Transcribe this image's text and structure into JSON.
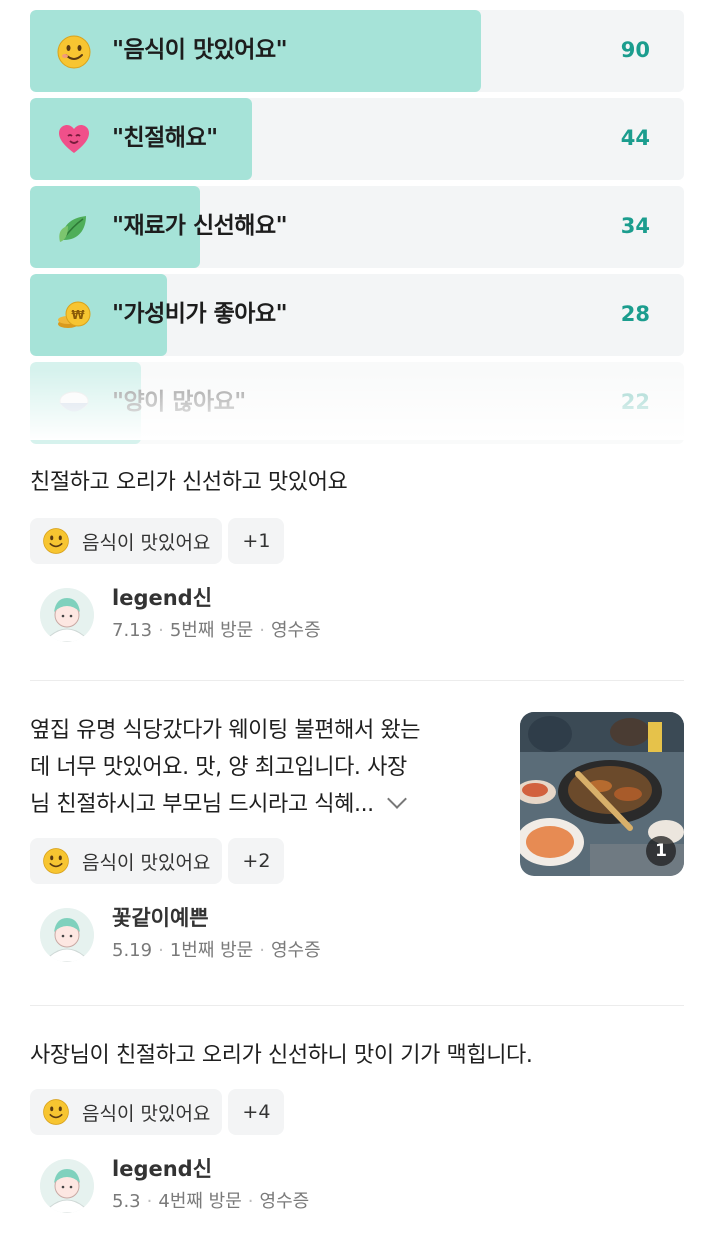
{
  "keywords": [
    {
      "label": "\"음식이 맛있어요\"",
      "count": "90",
      "fill": 0.69,
      "icon": "smile-icon"
    },
    {
      "label": "\"친절해요\"",
      "count": "44",
      "fill": 0.34,
      "icon": "heart-icon"
    },
    {
      "label": "\"재료가 신선해요\"",
      "count": "34",
      "fill": 0.26,
      "icon": "leaf-icon"
    },
    {
      "label": "\"가성비가 좋아요\"",
      "count": "28",
      "fill": 0.21,
      "icon": "coin-icon"
    },
    {
      "label": "\"양이 많아요\"",
      "count": "22",
      "fill": 0.17,
      "icon": "rice-bowl-icon"
    }
  ],
  "reviews": [
    {
      "text": "친절하고 오리가 신선하고 맛있어요",
      "tag": "음식이 맛있어요",
      "more": "+1",
      "author": "legend신",
      "date": "7.13",
      "visit": "5번째 방문",
      "proof": "영수증"
    },
    {
      "text_lines": [
        "옆집 유명 식당갔다가 웨이팅 불편해서 왔는",
        "데 너무 맛있어요. 맛, 양 최고입니다. 사장",
        "님 친절하시고 부모님 드시라고 식혜..."
      ],
      "tag": "음식이 맛있어요",
      "more": "+2",
      "author": "꽃같이예쁜",
      "date": "5.19",
      "visit": "1번째 방문",
      "proof": "영수증",
      "photo_count": "1"
    },
    {
      "text": "사장님이 친절하고 오리가 신선하니 맛이 기가 맥힙니다.",
      "tag": "음식이 맛있어요",
      "more": "+4",
      "author": "legend신",
      "date": "5.3",
      "visit": "4번째 방문",
      "proof": "영수증"
    }
  ],
  "colors": {
    "accent": "#1b9d8e",
    "bar_fill": "#a6e3d8",
    "bar_bg": "#f3f5f6"
  }
}
